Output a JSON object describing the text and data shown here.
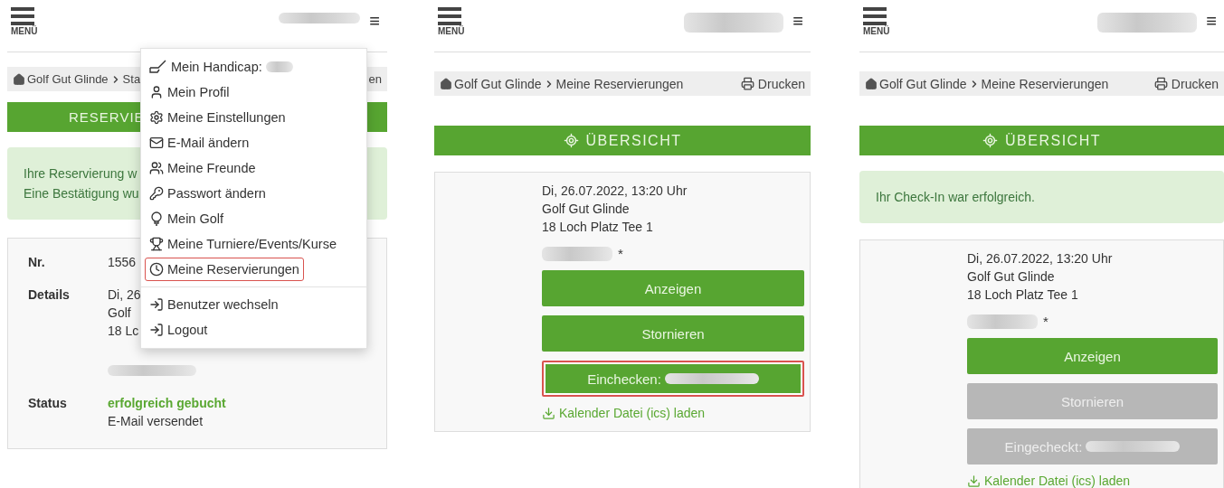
{
  "panels": [
    {
      "header": {
        "menu_label": "MENÜ",
        "user_glyph": "≡"
      },
      "breadcrumb": {
        "home": "Golf Gut Glinde",
        "current": "Sta",
        "tail": "en"
      },
      "section": {
        "kind": "cut",
        "title": "RESERVIE"
      },
      "alert": {
        "lines": [
          "Ihre Reservierung w",
          "Eine Bestätigung wu"
        ]
      },
      "card": {
        "kind": "details",
        "rows": [
          {
            "label": "Nr.",
            "lines": [
              {
                "kind": "text",
                "text": "1556"
              }
            ]
          },
          {
            "label": "Details",
            "lines": [
              {
                "kind": "text",
                "text": "Di, 26"
              },
              {
                "kind": "text",
                "text": "Golf"
              },
              {
                "kind": "text",
                "text": "18 Lc"
              },
              {
                "kind": "redacted"
              }
            ]
          },
          {
            "label": "Status",
            "lines": [
              {
                "kind": "success",
                "text": "erfolgreich gebucht"
              },
              {
                "kind": "text",
                "text": "E-Mail versendet"
              }
            ]
          }
        ]
      },
      "menu": {
        "items": [
          {
            "label": "Mein Handicap:",
            "redacted": true,
            "selected": false
          },
          {
            "label": "Mein Profil",
            "redacted": false,
            "selected": false
          },
          {
            "label": "Meine Einstellungen",
            "redacted": false,
            "selected": false
          },
          {
            "label": "E-Mail ändern",
            "redacted": false,
            "selected": false
          },
          {
            "label": "Meine Freunde",
            "redacted": false,
            "selected": false
          },
          {
            "label": "Passwort ändern",
            "redacted": false,
            "selected": false
          },
          {
            "label": "Mein Golf",
            "redacted": false,
            "selected": false
          },
          {
            "label": "Meine Turniere/Events/Kurse",
            "redacted": false,
            "selected": false
          },
          {
            "label": "Meine Reservierungen",
            "redacted": false,
            "selected": true
          }
        ],
        "footer_items": [
          {
            "label": "Benutzer wechseln",
            "selected": false
          },
          {
            "label": "Logout",
            "selected": false
          }
        ]
      }
    },
    {
      "header": {
        "menu_label": "MENÜ",
        "user_glyph": "≡"
      },
      "breadcrumb": {
        "home": "Golf Gut Glinde",
        "current": "Meine Reservierungen",
        "print_label": "Drucken"
      },
      "section": {
        "kind": "overview",
        "title": "ÜBERSICHT"
      },
      "card": {
        "kind": "booking",
        "lines": [
          "Di, 26.07.2022, 13:20 Uhr",
          "Golf Gut Glinde",
          "18 Loch Platz Tee 1"
        ],
        "player": {
          "suffix": "*"
        },
        "buttons": [
          {
            "label": "Anzeigen",
            "redacted": false,
            "disabled": false,
            "selected": false
          },
          {
            "label": "Stornieren",
            "redacted": false,
            "disabled": false,
            "selected": false
          },
          {
            "label": "Einchecken:",
            "redacted": true,
            "disabled": false,
            "selected": true
          }
        ],
        "link": "Kalender Datei (ics) laden"
      }
    },
    {
      "header": {
        "menu_label": "MENÜ",
        "user_glyph": "≡"
      },
      "breadcrumb": {
        "home": "Golf Gut Glinde",
        "current": "Meine Reservierungen",
        "print_label": "Drucken"
      },
      "section": {
        "kind": "overview",
        "title": "ÜBERSICHT"
      },
      "alert": {
        "lines": [
          "Ihr Check-In war erfolgreich."
        ]
      },
      "card": {
        "kind": "booking",
        "lines": [
          "Di, 26.07.2022, 13:20 Uhr",
          "Golf Gut Glinde",
          "18 Loch Platz Tee 1"
        ],
        "player": {
          "suffix": "*"
        },
        "buttons": [
          {
            "label": "Anzeigen",
            "redacted": false,
            "disabled": false,
            "selected": false
          },
          {
            "label": "Stornieren",
            "redacted": false,
            "disabled": true,
            "selected": false
          },
          {
            "label": "Eingecheckt:",
            "redacted": true,
            "disabled": true,
            "selected": false
          }
        ],
        "link": "Kalender Datei (ics) laden"
      }
    }
  ]
}
